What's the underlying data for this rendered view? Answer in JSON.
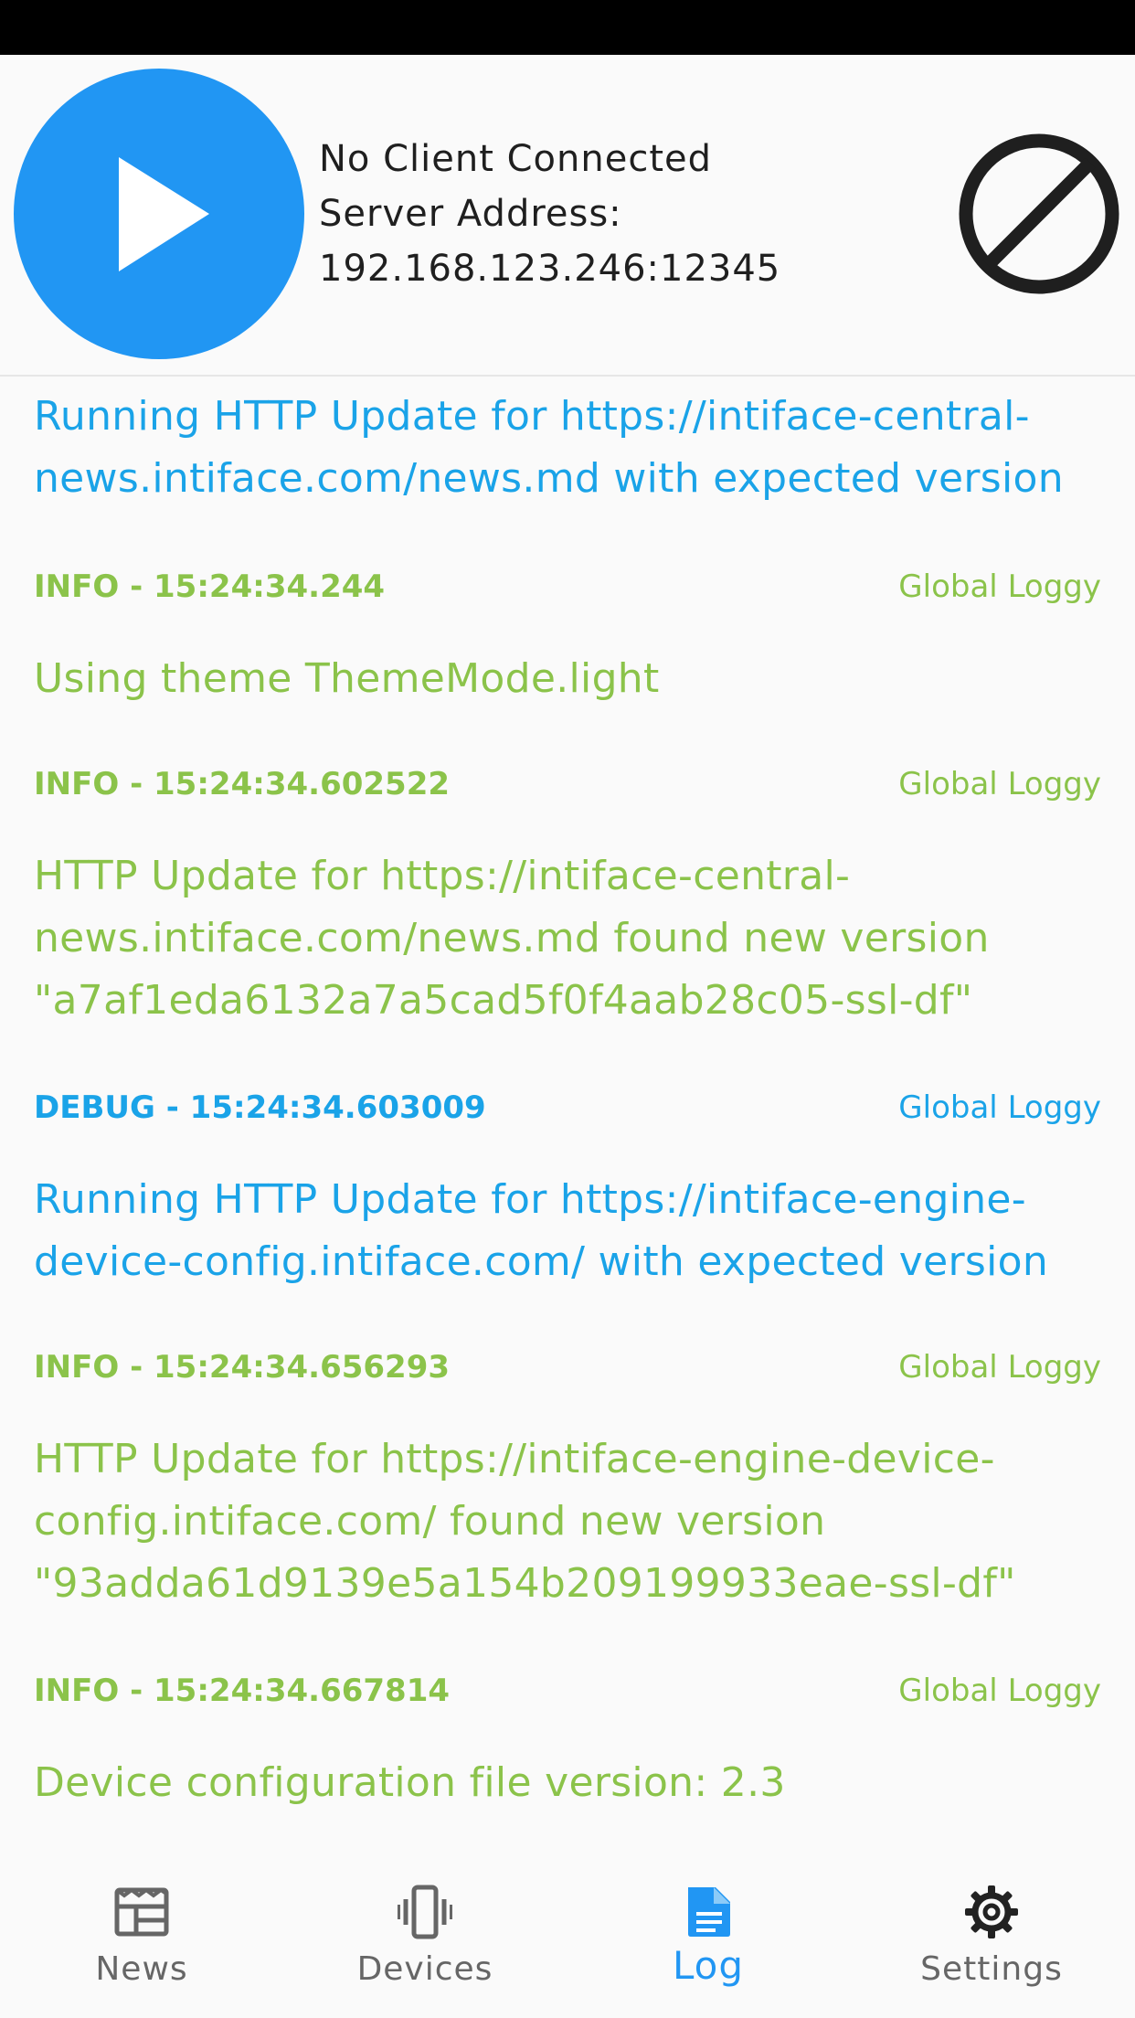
{
  "colors": {
    "accent": "#2196f3",
    "info": "#8bc34a",
    "debug": "#1aa3e8",
    "nav_inactive": "#666666",
    "status_bar": "#000000"
  },
  "header": {
    "status": "No Client Connected",
    "address_label": "Server Address:",
    "address_value": "192.168.123.246:12345",
    "play_icon": "play-icon",
    "stop_icon": "block-icon"
  },
  "log": {
    "partial_message": "Running HTTP Update for https://intiface-central-news.intiface.com/news.md with expected version",
    "entries": [
      {
        "level_time": "INFO - 15:24:34.244",
        "logger": "Global Loggy",
        "message": "Using theme ThemeMode.light"
      },
      {
        "level_time": "INFO - 15:24:34.602522",
        "logger": "Global Loggy",
        "message": "HTTP Update for https://intiface-central-news.intiface.com/news.md found new version \"a7af1eda6132a7a5cad5f0f4aab28c05-ssl-df\""
      },
      {
        "level_time": "DEBUG - 15:24:34.603009",
        "logger": "Global Loggy",
        "message": "Running HTTP Update for https://intiface-engine-device-config.intiface.com/ with expected version"
      },
      {
        "level_time": "INFO - 15:24:34.656293",
        "logger": "Global Loggy",
        "message": "HTTP Update for https://intiface-engine-device-config.intiface.com/ found new version \"93adda61d9139e5a154b209199933eae-ssl-df\""
      },
      {
        "level_time": "INFO - 15:24:34.667814",
        "logger": "Global Loggy",
        "message": "Device configuration file version: 2.3"
      }
    ]
  },
  "nav": {
    "items": [
      {
        "label": "News",
        "icon": "news-icon"
      },
      {
        "label": "Devices",
        "icon": "vibration-icon"
      },
      {
        "label": "Log",
        "icon": "document-icon",
        "active": true
      },
      {
        "label": "Settings",
        "icon": "gear-icon"
      }
    ]
  }
}
